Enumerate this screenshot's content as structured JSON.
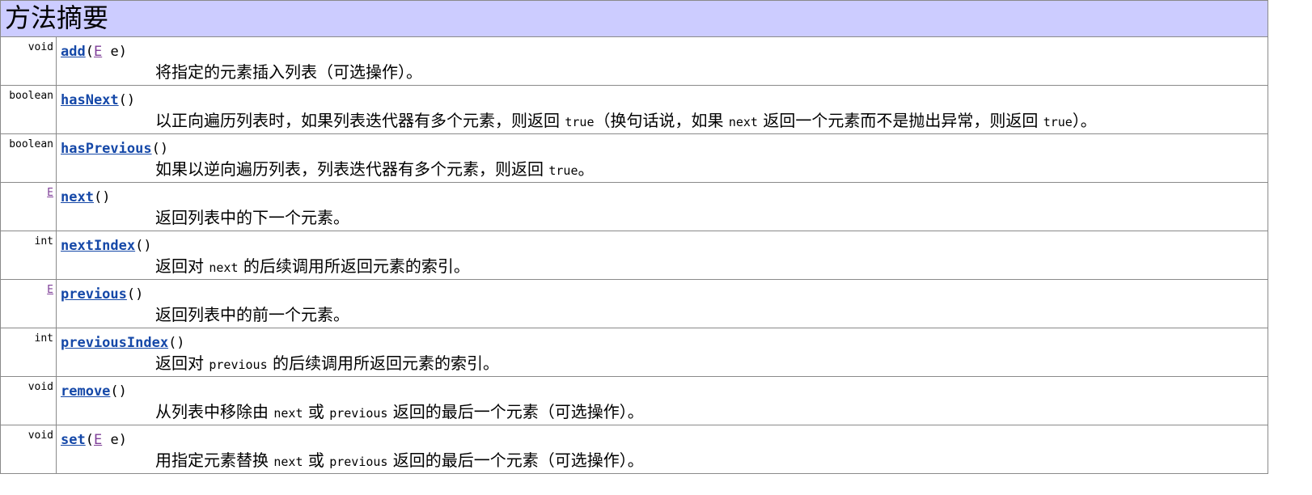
{
  "title": "方法摘要",
  "methods": [
    {
      "return_type": "void",
      "name": "add",
      "params": {
        "open": "(",
        "type": "E",
        "rest": " e)"
      },
      "description": {
        "p1": "将指定的元素插入列表（可选操作）。"
      }
    },
    {
      "return_type": "boolean",
      "name": "hasNext",
      "params": {
        "open": "()"
      },
      "description": {
        "p1": "以正向遍历列表时，如果列表迭代器有多个元素，则返回 ",
        "c1": "true",
        "p2": "（换句话说，如果 ",
        "c2": "next",
        "p3": " 返回一个元素而不是抛出异常，则返回 ",
        "c3": "true",
        "p4": "）。"
      }
    },
    {
      "return_type": "boolean",
      "name": "hasPrevious",
      "params": {
        "open": "()"
      },
      "description": {
        "p1": "如果以逆向遍历列表，列表迭代器有多个元素，则返回 ",
        "c1": "true",
        "p2": "。"
      }
    },
    {
      "return_type": "E",
      "name": "next",
      "params": {
        "open": "()"
      },
      "description": {
        "p1": "返回列表中的下一个元素。"
      }
    },
    {
      "return_type": "int",
      "name": "nextIndex",
      "params": {
        "open": "()"
      },
      "description": {
        "p1": "返回对 ",
        "c1": "next",
        "p2": " 的后续调用所返回元素的索引。"
      }
    },
    {
      "return_type": "E",
      "name": "previous",
      "params": {
        "open": "()"
      },
      "description": {
        "p1": "返回列表中的前一个元素。"
      }
    },
    {
      "return_type": "int",
      "name": "previousIndex",
      "params": {
        "open": "()"
      },
      "description": {
        "p1": "返回对 ",
        "c1": "previous",
        "p2": " 的后续调用所返回元素的索引。"
      }
    },
    {
      "return_type": "void",
      "name": "remove",
      "params": {
        "open": "()"
      },
      "description": {
        "p1": "从列表中移除由 ",
        "c1": "next",
        "p2": " 或 ",
        "c2": "previous",
        "p3": " 返回的最后一个元素（可选操作）。"
      }
    },
    {
      "return_type": "void",
      "name": "set",
      "params": {
        "open": "(",
        "type": "E",
        "rest": " e)"
      },
      "description": {
        "p1": "用指定元素替换 ",
        "c1": "next",
        "p2": " 或 ",
        "c2": "previous",
        "p3": " 返回的最后一个元素（可选操作）。"
      }
    }
  ],
  "colors": {
    "header_bg": "#ccccff",
    "method_link": "#1548a8",
    "type_link": "#7f3f98",
    "border": "#8a8a8a"
  }
}
